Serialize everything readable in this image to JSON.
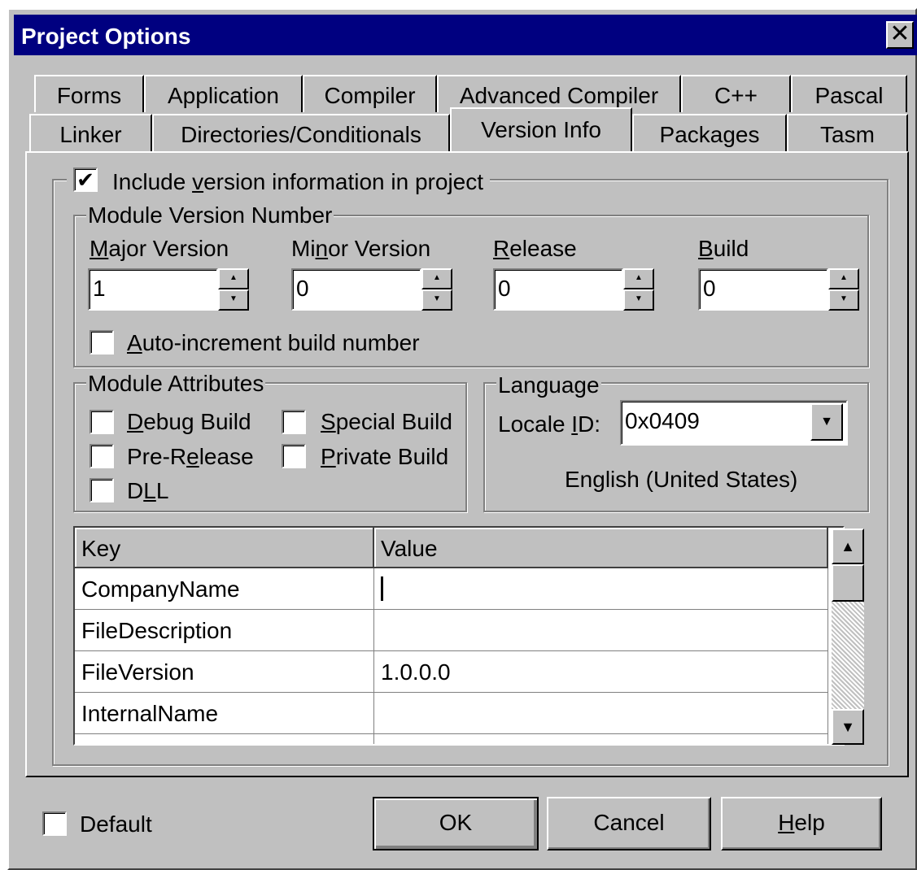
{
  "window": {
    "title": "Project Options",
    "close": "✕"
  },
  "tabs": {
    "row1": [
      "Forms",
      "Application",
      "Compiler",
      "Advanced Compiler",
      "C++",
      "Pascal"
    ],
    "row2": [
      "Linker",
      "Directories/Conditionals",
      "Version Info",
      "Packages",
      "Tasm"
    ],
    "selected": "Version Info"
  },
  "include_version": {
    "checked": "✔",
    "label_pre": "Include ",
    "label_u": "v",
    "label_post": "ersion information in project"
  },
  "module_version": {
    "legend": "Module Version Number",
    "major": {
      "label_u": "M",
      "label_post": "ajor Version",
      "value": "1"
    },
    "minor": {
      "label_pre": "Mi",
      "label_u": "n",
      "label_post": "or Version",
      "value": "0"
    },
    "release": {
      "label_u": "R",
      "label_post": "elease",
      "value": "0"
    },
    "build": {
      "label_u": "B",
      "label_post": "uild",
      "value": "0"
    },
    "auto_increment": {
      "label_u": "A",
      "label_post": "uto-increment build number"
    }
  },
  "attributes": {
    "legend": "Module Attributes",
    "debug": {
      "label_u": "D",
      "label_post": "ebug Build"
    },
    "special": {
      "label_u": "S",
      "label_post": "pecial Build"
    },
    "prerelease": {
      "label_pre": "Pre-R",
      "label_u": "e",
      "label_post": "lease"
    },
    "private": {
      "label_u": "P",
      "label_post": "rivate Build"
    },
    "dll": {
      "label_pre": "D",
      "label_u": "L",
      "label_post": "L"
    }
  },
  "language": {
    "legend": "Language",
    "locale_label_pre": "Locale ",
    "locale_label_u": "I",
    "locale_label_post": "D:",
    "locale_value": "0x0409",
    "language_name": "English (United States)"
  },
  "grid": {
    "headers": [
      "Key",
      "Value"
    ],
    "rows": [
      {
        "key": "CompanyName",
        "value": ""
      },
      {
        "key": "FileDescription",
        "value": ""
      },
      {
        "key": "FileVersion",
        "value": "1.0.0.0"
      },
      {
        "key": "InternalName",
        "value": ""
      }
    ]
  },
  "footer": {
    "default_label": "Default",
    "ok": "OK",
    "cancel": "Cancel",
    "help_u": "H",
    "help_post": "elp"
  },
  "icons": {
    "dropdown": "dropdown-arrow-icon",
    "spin_up": "spin-up-icon",
    "spin_down": "spin-down-icon"
  }
}
